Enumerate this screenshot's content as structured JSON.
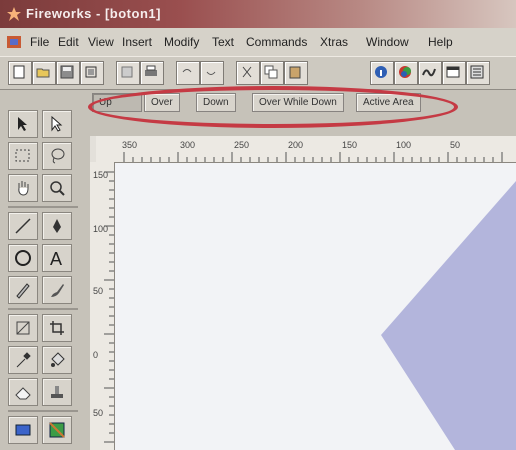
{
  "window": {
    "title": "Fireworks - [boton1]"
  },
  "menu": [
    "File",
    "Edit",
    "View",
    "Insert",
    "Modify",
    "Text",
    "Commands",
    "Xtras",
    "Window",
    "Help"
  ],
  "state_tabs": [
    "Up",
    "Over",
    "Down",
    "Over While Down",
    "Active Area"
  ],
  "active_state_tab": "Up",
  "ruler": {
    "horizontal_labels": [
      "350",
      "300",
      "250",
      "200",
      "150",
      "100",
      "50"
    ],
    "vertical_labels": [
      "150",
      "100",
      "50",
      "0",
      "50"
    ]
  },
  "colors": {
    "highlight_ellipse": "#c53a44",
    "shape_fill": "#b3b5dc",
    "canvas_bg": "#f2f3f6",
    "titlebar_start": "#7b3b3b"
  },
  "toolbar_icons": [
    "new-file-icon",
    "open-icon",
    "save-icon",
    "import-icon",
    "export-icon",
    "print-icon",
    "undo-icon",
    "redo-icon",
    "cut-icon",
    "copy-icon",
    "paste-icon",
    "info-icon",
    "color-icon",
    "stroke-icon",
    "layers-icon",
    "frames-icon"
  ],
  "tool_icons": [
    "pointer-icon",
    "subselect-icon",
    "marquee-icon",
    "lasso-icon",
    "hand-icon",
    "zoom-icon",
    "line-icon",
    "pen-icon",
    "ellipse-icon",
    "text-icon",
    "pencil-icon",
    "brush-icon",
    "scale-icon",
    "crop-icon",
    "eyedropper-icon",
    "paint-bucket-icon",
    "eraser-icon",
    "rubber-stamp-icon",
    "hotspot-icon",
    "slice-icon"
  ]
}
